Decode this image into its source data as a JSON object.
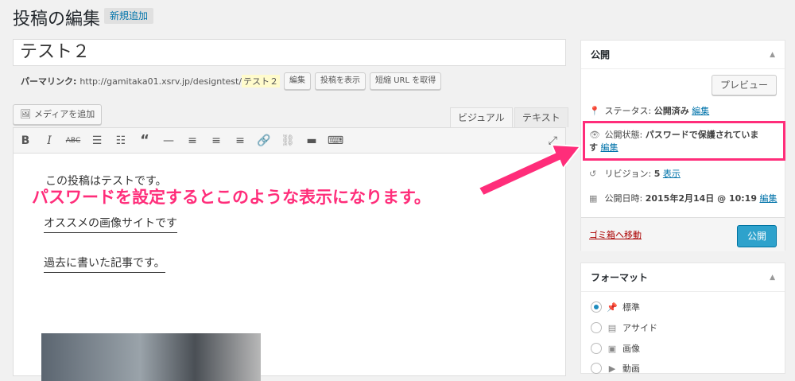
{
  "header": {
    "title": "投稿の編集",
    "add_new": "新規追加"
  },
  "post": {
    "title": "テスト２",
    "permalink_label": "パーマリンク:",
    "permalink_url": "http://gamitaka01.xsrv.jp/designtest/",
    "permalink_slug": "テスト２",
    "edit_button": "編集",
    "view_button": "投稿を表示",
    "shortlink_button": "短縮 URL を取得"
  },
  "editor": {
    "add_media": "メディアを追加",
    "tab_visual": "ビジュアル",
    "tab_text": "テキスト",
    "toolbar_icons": [
      "bold-icon",
      "italic-icon",
      "strikethrough-icon",
      "bullet-list-icon",
      "numbered-list-icon",
      "blockquote-icon",
      "horizontal-line-icon",
      "align-left-icon",
      "align-center-icon",
      "align-right-icon",
      "link-icon",
      "unlink-icon",
      "read-more-icon",
      "toolbar-toggle-icon",
      "fullscreen-icon"
    ],
    "lines": [
      "この投稿はテストです。",
      "オススメの画像サイトです",
      "過去に書いた記事です。"
    ]
  },
  "annotation": {
    "text": "パスワードを設定するとこのような表示になります。",
    "color": "#ff2d7a"
  },
  "publish": {
    "title": "公開",
    "preview": "プレビュー",
    "status_label": "ステータス:",
    "status_value": "公開済み",
    "status_edit": "編集",
    "visibility_label": "公開状態:",
    "visibility_value": "パスワードで保護されていま",
    "visibility_value2": "す",
    "visibility_edit": "編集",
    "revision_label": "リビジョン:",
    "revision_count": "5",
    "revision_link": "表示",
    "date_label": "公開日時:",
    "date_value": "2015年2月14日 @ 10:19",
    "date_edit": "編集",
    "trash": "ゴミ箱へ移動",
    "publish_button": "公開"
  },
  "format": {
    "title": "フォーマット",
    "options": [
      {
        "label": "標準",
        "icon": "pin-icon",
        "selected": true
      },
      {
        "label": "アサイド",
        "icon": "aside-icon",
        "selected": false
      },
      {
        "label": "画像",
        "icon": "image-icon",
        "selected": false
      },
      {
        "label": "動画",
        "icon": "video-icon",
        "selected": false
      }
    ]
  }
}
